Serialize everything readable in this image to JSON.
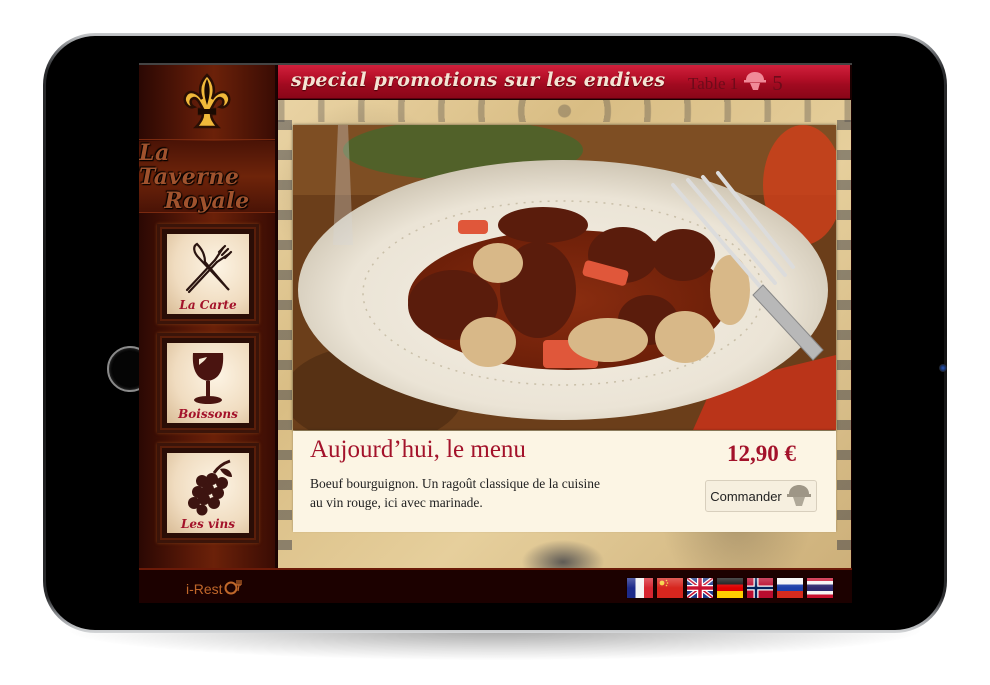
{
  "app": {
    "brand_line1": "La Taverne",
    "brand_line2": "Royale",
    "logo_icon": "fleur-de-lis-icon"
  },
  "header": {
    "promo_text": "special promotions sur les endives",
    "table_label": "Table 1",
    "guest_icon": "waiter-cloche-icon",
    "guest_count": "5",
    "menu_icon": "hamburger-menu-icon"
  },
  "sidebar": {
    "items": [
      {
        "label": "La Carte",
        "icon": "fork-knife-icon"
      },
      {
        "label": "Boissons",
        "icon": "wine-glass-icon"
      },
      {
        "label": "Les vins",
        "icon": "grapes-icon"
      }
    ]
  },
  "dish": {
    "image_alt": "Boeuf bourguignon dans une assiette blanche",
    "title": "Aujourd’hui, le menu",
    "description": "Boeuf bourguignon. Un ragoût classique de la cuisine\n au vin rouge, ici avec marinade.",
    "price": "12,90 €",
    "order_label": "Commander",
    "order_icon": "cloche-serving-icon"
  },
  "footer": {
    "logo_text": "i-Rest",
    "languages": [
      {
        "code": "fr",
        "name": "Français"
      },
      {
        "code": "cn",
        "name": "中文"
      },
      {
        "code": "gb",
        "name": "English"
      },
      {
        "code": "de",
        "name": "Deutsch"
      },
      {
        "code": "no",
        "name": "Norsk"
      },
      {
        "code": "ru",
        "name": "Русский"
      },
      {
        "code": "th",
        "name": "ไทย"
      }
    ]
  },
  "colors": {
    "accent_red": "#a3122a",
    "header_red": "#b50f28",
    "sidebar_brown": "#5c1a08",
    "card_cream": "#fcf5e4",
    "logo_orange": "#c0672a"
  }
}
